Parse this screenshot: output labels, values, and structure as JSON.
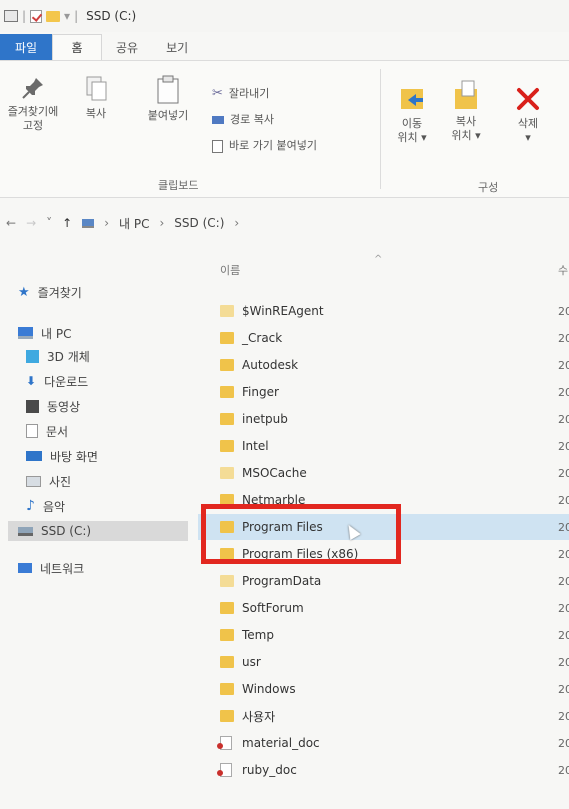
{
  "window": {
    "title": "SSD (C:)"
  },
  "tabs": [
    {
      "label": "파일"
    },
    {
      "label": "홈"
    },
    {
      "label": "공유"
    },
    {
      "label": "보기"
    }
  ],
  "ribbon": {
    "clipboard": {
      "pin_label_1": "즐겨찾기에",
      "pin_label_2": "고정",
      "copy_label": "복사",
      "paste_label": "붙여넣기",
      "cut_label": "잘라내기",
      "copy_path_label": "경로 복사",
      "paste_shortcut_label": "바로 가기 붙여넣기",
      "group_label": "클립보드"
    },
    "organize": {
      "move_label_1": "이동",
      "move_label_2": "위치 ▾",
      "copyto_label_1": "복사",
      "copyto_label_2": "위치 ▾",
      "delete_label": "삭제",
      "delete_arrow": "▾",
      "group_label": "구성"
    }
  },
  "address": {
    "back": "←",
    "forward": "→",
    "dropdown": "˅",
    "up": "↑",
    "sep": "›",
    "pc": "내 PC",
    "drive": "SSD (C:)"
  },
  "nav": {
    "items": [
      {
        "label": "즐겨찾기"
      },
      {
        "label": "내 PC"
      },
      {
        "label": "3D 개체"
      },
      {
        "label": "다운로드"
      },
      {
        "label": "동영상"
      },
      {
        "label": "문서"
      },
      {
        "label": "바탕 화면"
      },
      {
        "label": "사진"
      },
      {
        "label": "음악"
      },
      {
        "label": "SSD (C:)"
      },
      {
        "label": "네트워크"
      }
    ]
  },
  "list": {
    "header_name": "이름",
    "header_date": "수",
    "sort_arrow": "^",
    "rows": [
      {
        "name": "$WinREAgent",
        "date": "20"
      },
      {
        "name": "_Crack",
        "date": "20"
      },
      {
        "name": "Autodesk",
        "date": "20"
      },
      {
        "name": "Finger",
        "date": "20"
      },
      {
        "name": "inetpub",
        "date": "20"
      },
      {
        "name": "Intel",
        "date": "20"
      },
      {
        "name": "MSOCache",
        "date": "20"
      },
      {
        "name": "Netmarble",
        "date": "20"
      },
      {
        "name": "Program Files",
        "date": "20"
      },
      {
        "name": "Program Files (x86)",
        "date": "20"
      },
      {
        "name": "ProgramData",
        "date": "20"
      },
      {
        "name": "SoftForum",
        "date": "20"
      },
      {
        "name": "Temp",
        "date": "20"
      },
      {
        "name": "usr",
        "date": "20"
      },
      {
        "name": "Windows",
        "date": "20"
      },
      {
        "name": "사용자",
        "date": "20"
      },
      {
        "name": "material_doc",
        "date": "20"
      },
      {
        "name": "ruby_doc",
        "date": "20"
      }
    ]
  },
  "colors": {
    "accent": "#2f75c9",
    "highlight": "#cfe3f2",
    "annotation": "#e2271f"
  }
}
